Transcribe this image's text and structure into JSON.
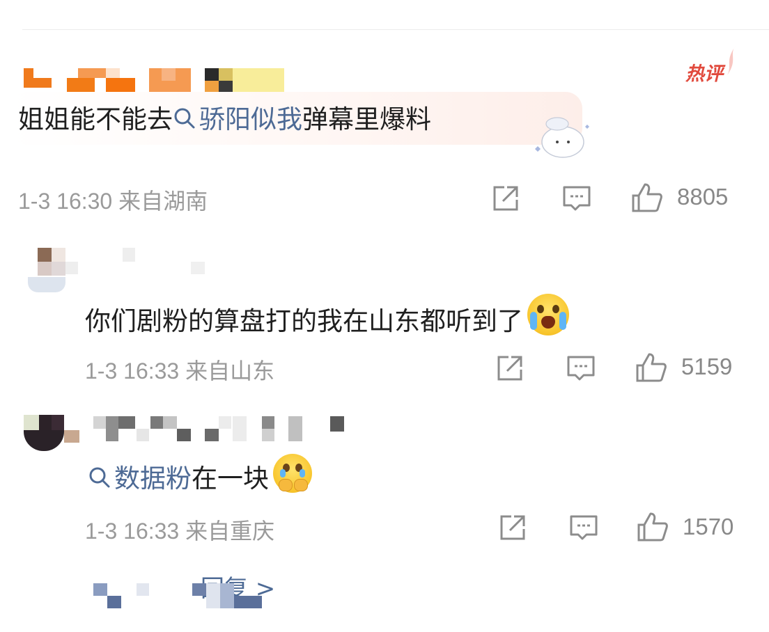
{
  "comments": [
    {
      "text_plain": "姐姐能不能去",
      "topic": "骄阳似我",
      "text_after": "弹幕里爆料",
      "badge": "热评",
      "time": "1-3 16:30",
      "location": "来自湖南",
      "likes": "8805"
    },
    {
      "text_plain": "你们剧粉的算盘打的我在山东都听到了",
      "emoji": "loudly-crying-face",
      "time": "1-3 16:33",
      "location": "来自山东",
      "likes": "5159"
    },
    {
      "topic": "数据粉",
      "text_after": "在一块",
      "emoji": "face-holding-back-tears",
      "time": "1-3 16:33",
      "location": "来自重庆",
      "likes": "1570"
    }
  ],
  "more_replies": "回复 >",
  "colors": {
    "topic": "#4d6a95",
    "meta": "#9a9a9a",
    "hot_badge": "#e14a3d"
  }
}
